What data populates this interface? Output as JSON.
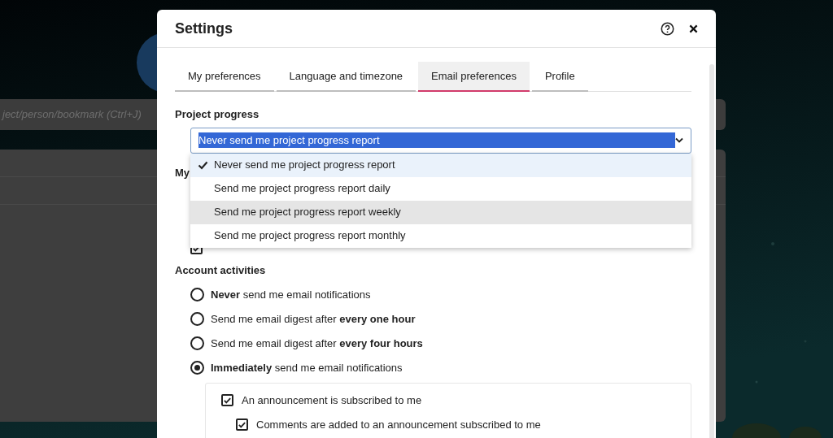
{
  "background": {
    "search_placeholder": "ject/person/bookmark (Ctrl+J)"
  },
  "dialog": {
    "title": "Settings",
    "tabs": [
      {
        "label": "My preferences",
        "selected": false
      },
      {
        "label": "Language and timezone",
        "selected": false
      },
      {
        "label": "Email preferences",
        "selected": true
      },
      {
        "label": "Profile",
        "selected": false
      }
    ],
    "project_progress": {
      "label": "Project progress",
      "value": "Never send me project progress report",
      "expanded": true,
      "options": [
        {
          "label": "Never send me project progress report",
          "selected": true,
          "hovered": false
        },
        {
          "label": "Send me project progress report daily",
          "selected": false,
          "hovered": false
        },
        {
          "label": "Send me project progress report weekly",
          "selected": false,
          "hovered": true
        },
        {
          "label": "Send me project progress report monthly",
          "selected": false,
          "hovered": false
        }
      ]
    },
    "my_section": {
      "heading": "My",
      "items": [
        {
          "checked": true
        }
      ]
    },
    "account_activities": {
      "heading": "Account activities",
      "options": [
        {
          "label": "**Never** send me email notifications",
          "selected": false
        },
        {
          "label": "Send me email digest after **every one hour**",
          "selected": false
        },
        {
          "label": "Send me email digest after **every four hours**",
          "selected": false
        },
        {
          "label": "**Immediately** send me email notifications",
          "selected": true
        }
      ]
    },
    "notifications": [
      {
        "label": "An announcement is subscribed to me",
        "checked": true,
        "children": [
          {
            "label": "Comments are added to an announcement subscribed to me",
            "checked": true
          }
        ]
      }
    ]
  }
}
